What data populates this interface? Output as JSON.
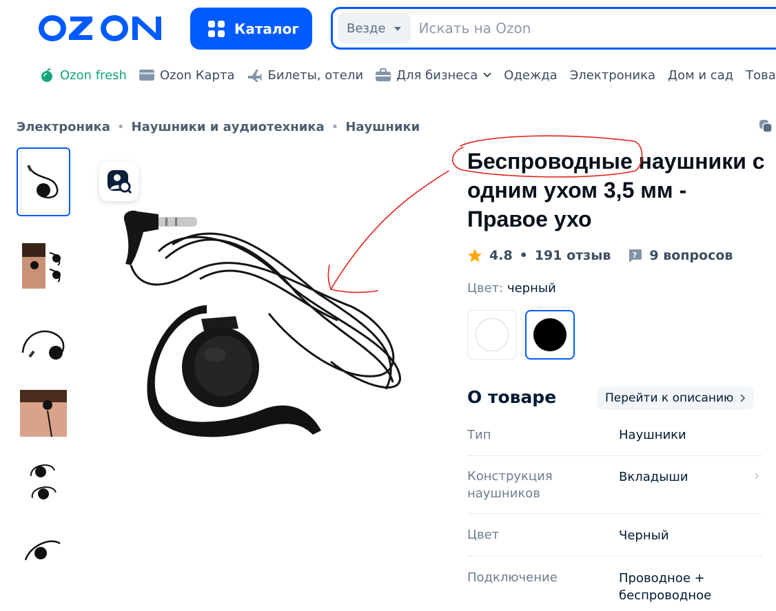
{
  "header": {
    "logo_text": "OZON",
    "catalog_label": "Каталог",
    "search_scope": "Везде",
    "search_placeholder": "Искать на Ozon"
  },
  "nav": {
    "items": [
      {
        "label": "Ozon fresh",
        "icon": "fresh-icon"
      },
      {
        "label": "Ozon Карта",
        "icon": "card-icon"
      },
      {
        "label": "Билеты, отели",
        "icon": "plane-icon"
      },
      {
        "label": "Для бизнеса",
        "icon": "briefcase-icon"
      },
      {
        "label": "Одежда"
      },
      {
        "label": "Электроника"
      },
      {
        "label": "Дом и сад"
      },
      {
        "label": "Товары"
      }
    ]
  },
  "breadcrumb": [
    "Электроника",
    "Наушники и аудиотехника",
    "Наушники"
  ],
  "product": {
    "title_highlighted": "Беспроводные",
    "title_rest": " наушники с одним ухом 3,5 мм - Правое ухо",
    "rating": "4.8",
    "reviews": "191 отзыв",
    "separator": "•",
    "questions": "9 вопросов",
    "color_label": "Цвет:",
    "color_value": "черный",
    "swatches": [
      {
        "name": "white",
        "color": "#ffffff",
        "selected": false
      },
      {
        "name": "black",
        "color": "#000000",
        "selected": true
      }
    ]
  },
  "about": {
    "title": "О товаре",
    "goto_label": "Перейти к описанию",
    "specs": [
      {
        "label": "Тип",
        "value": "Наушники"
      },
      {
        "label": "Конструкция наушников",
        "value": "Вкладыши"
      },
      {
        "label": "Цвет",
        "value": "Черный"
      },
      {
        "label": "Подключение",
        "value": "Проводное + беспроводное"
      }
    ]
  },
  "colors": {
    "brand": "#005bff",
    "annotation": "#e0241b",
    "star": "#ffa800",
    "fresh": "#10a57a"
  }
}
